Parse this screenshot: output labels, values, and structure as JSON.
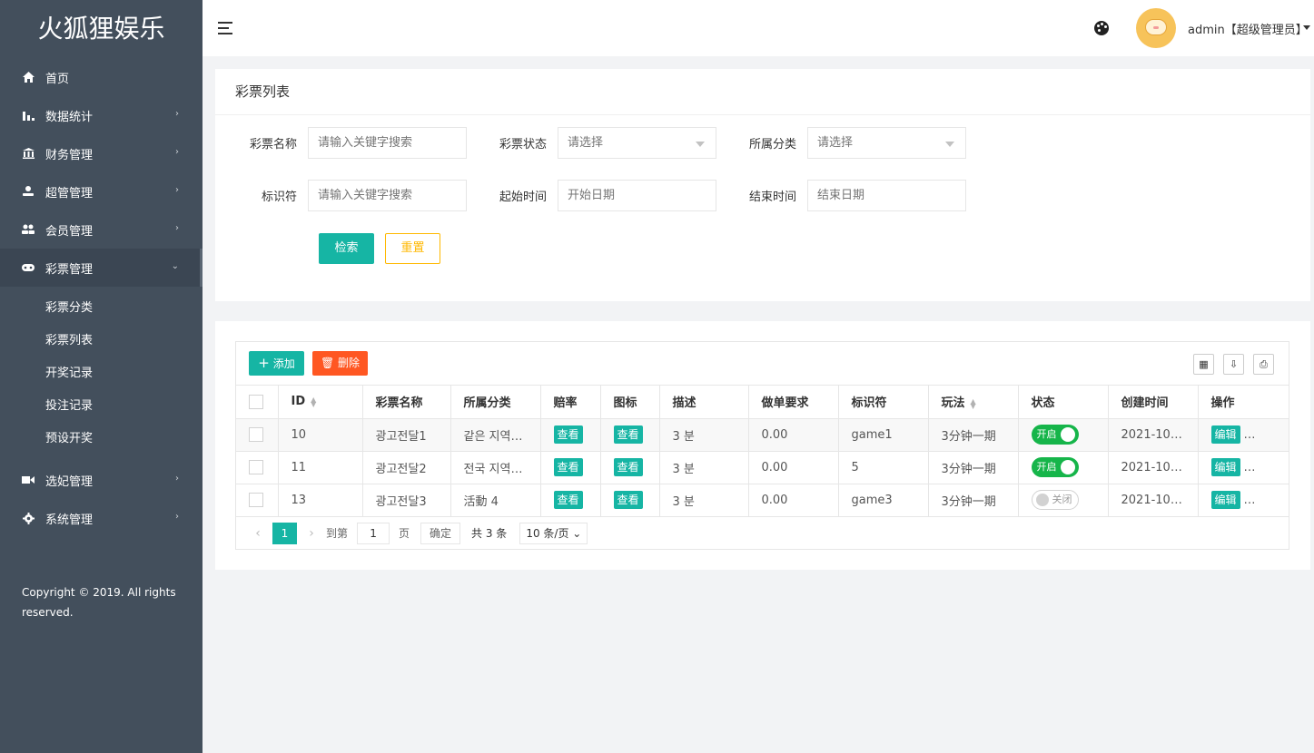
{
  "brand": "火狐狸娱乐",
  "sidebar": {
    "items": [
      {
        "label": "首页",
        "icon": "home-icon"
      },
      {
        "label": "数据统计",
        "icon": "bar-chart-icon"
      },
      {
        "label": "财务管理",
        "icon": "bank-icon"
      },
      {
        "label": "超管管理",
        "icon": "user-icon"
      },
      {
        "label": "会员管理",
        "icon": "users-icon"
      },
      {
        "label": "彩票管理",
        "icon": "gamepad-icon"
      },
      {
        "label": "选妃管理",
        "icon": "video-icon"
      },
      {
        "label": "系统管理",
        "icon": "gear-icon"
      }
    ],
    "sub_items": [
      "彩票分类",
      "彩票列表",
      "开奖记录",
      "投注记录",
      "预设开奖"
    ],
    "copyright": "Copyright © 2019. All rights reserved."
  },
  "header": {
    "user": "admin【超级管理员】"
  },
  "search": {
    "title": "彩票列表",
    "name_label": "彩票名称",
    "name_placeholder": "请输入关键字搜索",
    "status_label": "彩票状态",
    "status_value": "请选择",
    "category_label": "所属分类",
    "category_value": "请选择",
    "key_label": "标识符",
    "key_placeholder": "请输入关键字搜索",
    "start_label": "起始时间",
    "start_placeholder": "开始日期",
    "end_label": "结束时间",
    "end_placeholder": "结束日期",
    "search_button": "检索",
    "reset_button": "重置"
  },
  "toolbar": {
    "add": "添加",
    "delete": "删除"
  },
  "table": {
    "headers": [
      "ID",
      "彩票名称",
      "所属分类",
      "赔率",
      "图标",
      "描述",
      "做单要求",
      "标识符",
      "玩法",
      "状态",
      "创建时间",
      "操作"
    ],
    "rows": [
      {
        "id": "10",
        "name": "광고전달1",
        "category": "같은 지역…",
        "odds": "查看",
        "icon": "查看",
        "desc": "3 분",
        "req": "0.00",
        "key": "game1",
        "play": "3分钟一期",
        "status": "开启",
        "on": true,
        "created": "2021-10-…",
        "op": "编辑"
      },
      {
        "id": "11",
        "name": "광고전달2",
        "category": "전국 지역…",
        "odds": "查看",
        "icon": "查看",
        "desc": "3 분",
        "req": "0.00",
        "key": "5",
        "play": "3分钟一期",
        "status": "开启",
        "on": true,
        "created": "2021-10-…",
        "op": "编辑"
      },
      {
        "id": "13",
        "name": "광고전달3",
        "category": "活動 4",
        "odds": "查看",
        "icon": "查看",
        "desc": "3 분",
        "req": "0.00",
        "key": "game3",
        "play": "3分钟一期",
        "status": "关闭",
        "on": false,
        "created": "2021-10-…",
        "op": "编辑"
      }
    ]
  },
  "pager": {
    "current": "1",
    "goto_label": "到第",
    "goto_value": "1",
    "page_label": "页",
    "confirm": "确定",
    "total": "共 3 条",
    "page_size": "10 条/页"
  }
}
